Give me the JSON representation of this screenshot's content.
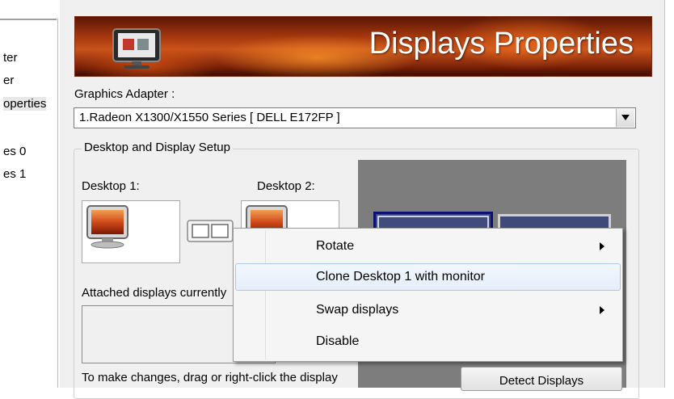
{
  "tree": {
    "items": [
      {
        "label": "ter"
      },
      {
        "label": "er"
      },
      {
        "label": "operties",
        "selected": true
      },
      {
        "label": "es 0"
      },
      {
        "label": "es 1"
      }
    ]
  },
  "banner": {
    "title": "Displays Properties",
    "icon": "display-properties-icon"
  },
  "adapter": {
    "label": "Graphics Adapter :",
    "selected_value": "1.Radeon X1300/X1550 Series   [ DELL E172FP ]"
  },
  "setup": {
    "group_title": "Desktop and Display Setup",
    "desktop1_label": "Desktop 1:",
    "desktop2_label": "Desktop 2:",
    "attached_label": "Attached displays currently",
    "hint": "To make changes, drag or right-click the display",
    "detect_button": "Detect Displays"
  },
  "context_menu": {
    "items": [
      {
        "label": "Rotate",
        "submenu": true
      },
      {
        "label": "Clone Desktop 1 with monitor",
        "highlighted": true
      },
      {
        "label": "Swap displays",
        "submenu": true
      },
      {
        "label": "Disable"
      }
    ]
  },
  "colors": {
    "banner_gradient": "#a8390e",
    "selected_monitor_border": "#0a1070",
    "monitor_fill": "#3f4a78",
    "preview_bg": "#7d7d7d",
    "menu_highlight": "#e4eefa"
  }
}
